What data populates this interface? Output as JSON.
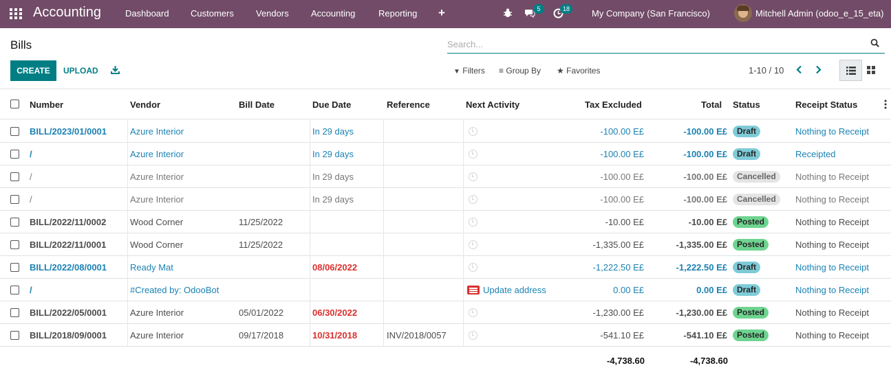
{
  "navbar": {
    "brand": "Accounting",
    "menus": [
      "Dashboard",
      "Customers",
      "Vendors",
      "Accounting",
      "Reporting"
    ],
    "plus": "+",
    "chat_count": "5",
    "activity_count": "18",
    "company": "My Company (San Francisco)",
    "user": "Mitchell Admin (odoo_e_15_eta)"
  },
  "page": {
    "title": "Bills"
  },
  "search": {
    "placeholder": "Search..."
  },
  "buttons": {
    "create": "CREATE",
    "upload": "UPLOAD"
  },
  "filters": {
    "filters": "Filters",
    "group_by": "Group By",
    "favorites": "Favorites"
  },
  "pager": {
    "text": "1-10 / 10"
  },
  "columns": [
    "Number",
    "Vendor",
    "Bill Date",
    "Due Date",
    "Reference",
    "Next Activity",
    "Tax Excluded",
    "Total",
    "Status",
    "Receipt Status"
  ],
  "rows": [
    {
      "number": "BILL/2023/01/0001",
      "vendor": "Azure Interior",
      "bill_date": "",
      "due_date": "In 29 days",
      "reference": "",
      "activity": "",
      "tax_excluded": "-100.00 E£",
      "total": "-100.00 E£",
      "status": "Draft",
      "receipt_status": "Nothing to Receipt"
    },
    {
      "number": "/",
      "vendor": "Azure Interior",
      "bill_date": "",
      "due_date": "In 29 days",
      "reference": "",
      "activity": "",
      "tax_excluded": "-100.00 E£",
      "total": "-100.00 E£",
      "status": "Draft",
      "receipt_status": "Receipted"
    },
    {
      "number": "/",
      "vendor": "Azure Interior",
      "bill_date": "",
      "due_date": "In 29 days",
      "reference": "",
      "activity": "",
      "tax_excluded": "-100.00 E£",
      "total": "-100.00 E£",
      "status": "Cancelled",
      "receipt_status": "Nothing to Receipt"
    },
    {
      "number": "/",
      "vendor": "Azure Interior",
      "bill_date": "",
      "due_date": "In 29 days",
      "reference": "",
      "activity": "",
      "tax_excluded": "-100.00 E£",
      "total": "-100.00 E£",
      "status": "Cancelled",
      "receipt_status": "Nothing to Receipt"
    },
    {
      "number": "BILL/2022/11/0002",
      "vendor": "Wood Corner",
      "bill_date": "11/25/2022",
      "due_date": "",
      "reference": "",
      "activity": "",
      "tax_excluded": "-10.00 E£",
      "total": "-10.00 E£",
      "status": "Posted",
      "receipt_status": "Nothing to Receipt"
    },
    {
      "number": "BILL/2022/11/0001",
      "vendor": "Wood Corner",
      "bill_date": "11/25/2022",
      "due_date": "",
      "reference": "",
      "activity": "",
      "tax_excluded": "-1,335.00 E£",
      "total": "-1,335.00 E£",
      "status": "Posted",
      "receipt_status": "Nothing to Receipt"
    },
    {
      "number": "BILL/2022/08/0001",
      "vendor": "Ready Mat",
      "bill_date": "",
      "due_date": "08/06/2022",
      "reference": "",
      "activity": "",
      "tax_excluded": "-1,222.50 E£",
      "total": "-1,222.50 E£",
      "status": "Draft",
      "receipt_status": "Nothing to Receipt"
    },
    {
      "number": "/",
      "vendor": "#Created by: OdooBot",
      "bill_date": "",
      "due_date": "",
      "reference": "",
      "activity": "Update address",
      "tax_excluded": "0.00 E£",
      "total": "0.00 E£",
      "status": "Draft",
      "receipt_status": "Nothing to Receipt"
    },
    {
      "number": "BILL/2022/05/0001",
      "vendor": "Azure Interior",
      "bill_date": "05/01/2022",
      "due_date": "06/30/2022",
      "reference": "",
      "activity": "",
      "tax_excluded": "-1,230.00 E£",
      "total": "-1,230.00 E£",
      "status": "Posted",
      "receipt_status": "Nothing to Receipt"
    },
    {
      "number": "BILL/2018/09/0001",
      "vendor": "Azure Interior",
      "bill_date": "09/17/2018",
      "due_date": "10/31/2018",
      "reference": "INV/2018/0057",
      "activity": "",
      "tax_excluded": "-541.10 E£",
      "total": "-541.10 E£",
      "status": "Posted",
      "receipt_status": "Nothing to Receipt"
    }
  ],
  "totals": {
    "tax_excluded": "-4,738.60",
    "total": "-4,738.60"
  }
}
